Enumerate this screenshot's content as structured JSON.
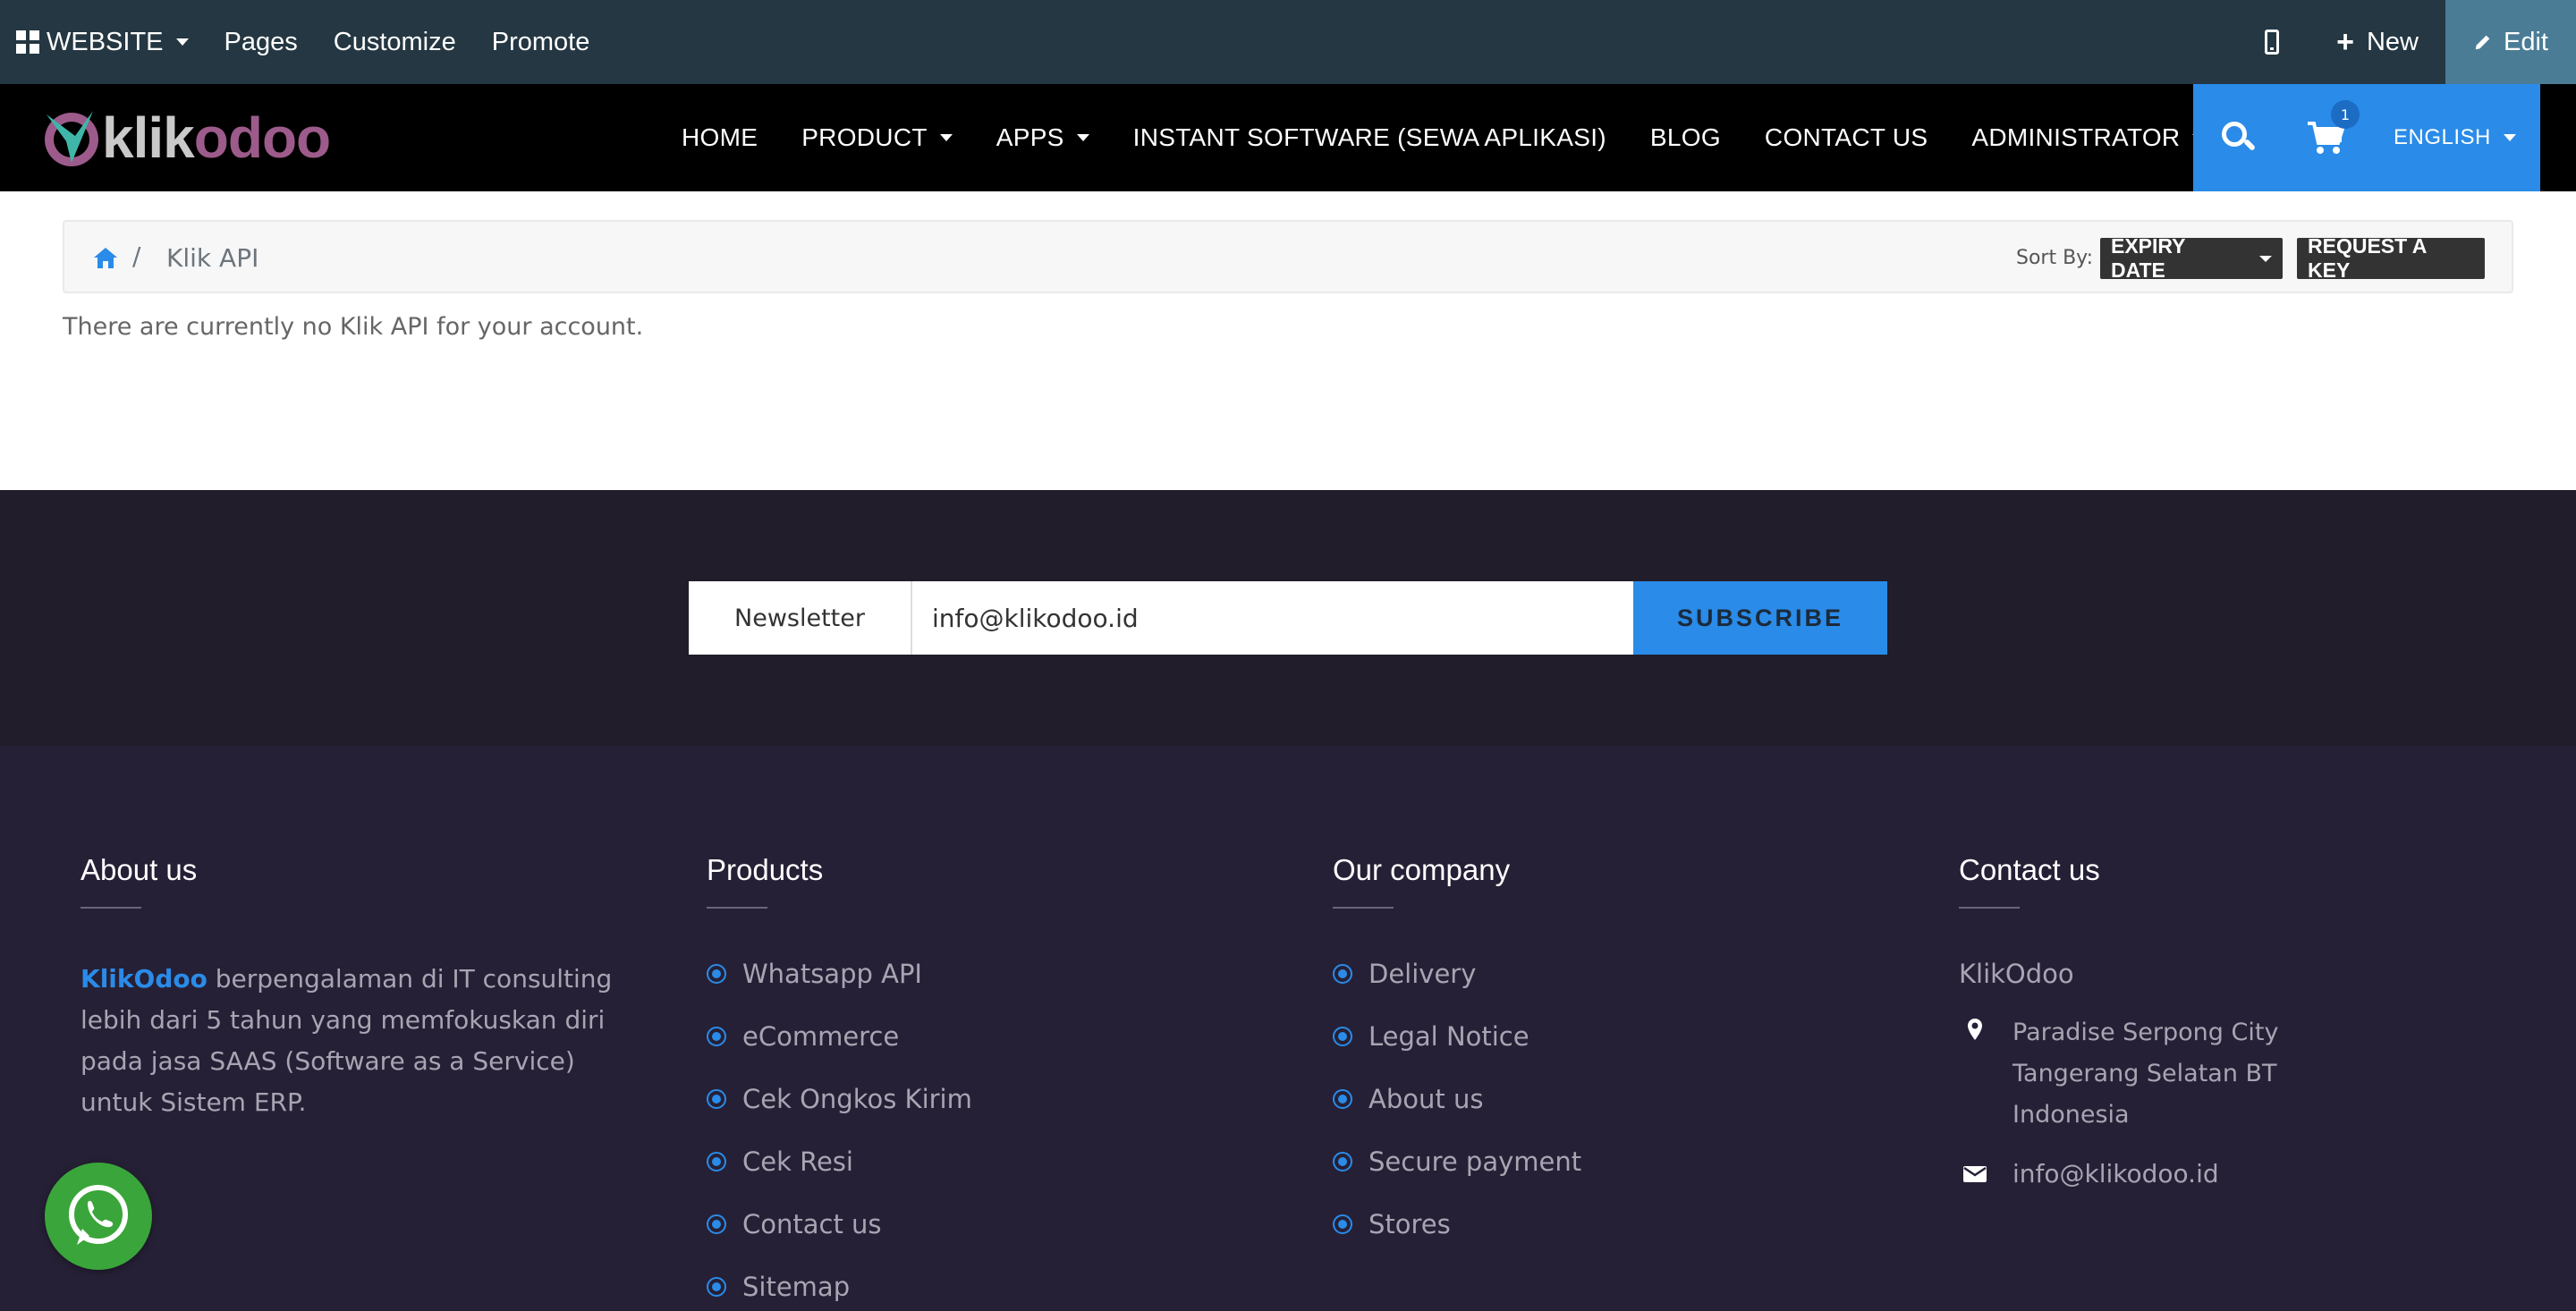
{
  "editbar": {
    "website_label": "WEBSITE",
    "pages_label": "Pages",
    "customize_label": "Customize",
    "promote_label": "Promote",
    "new_label": "New",
    "edit_label": "Edit"
  },
  "nav": {
    "logo_text_a": "klik",
    "logo_text_b": "odoo",
    "links": [
      {
        "label": "HOME",
        "caret": false
      },
      {
        "label": "PRODUCT",
        "caret": true
      },
      {
        "label": "APPS",
        "caret": true
      },
      {
        "label": "INSTANT SOFTWARE (SEWA APLIKASI)",
        "caret": false
      },
      {
        "label": "BLOG",
        "caret": false
      },
      {
        "label": "CONTACT US",
        "caret": false
      },
      {
        "label": "ADMINISTRATOR",
        "caret": true
      }
    ],
    "cart_count": "1",
    "language": "ENGLISH",
    "accent_color": "#2a8be8"
  },
  "breadcrumb": {
    "current": "Klik API",
    "sort_by_label": "Sort By:",
    "sort_value": "EXPIRY DATE",
    "request_key_label": "REQUEST A KEY"
  },
  "main": {
    "empty_message": "There are currently no Klik API for your account."
  },
  "newsletter": {
    "label": "Newsletter",
    "input_value": "info@klikodoo.id",
    "button_label": "SUBSCRIBE"
  },
  "footer": {
    "about": {
      "title": "About us",
      "brand": "KlikOdoo",
      "text": " berpengalaman di IT consulting lebih dari 5 tahun yang memfokuskan diri pada jasa SAAS (Software as a Service) untuk Sistem ERP."
    },
    "products": {
      "title": "Products",
      "items": [
        "Whatsapp API",
        "eCommerce",
        "Cek Ongkos Kirim",
        "Cek Resi",
        "Contact us",
        "Sitemap"
      ]
    },
    "company": {
      "title": "Our company",
      "items": [
        "Delivery",
        "Legal Notice",
        "About us",
        "Secure payment",
        "Stores"
      ]
    },
    "contact": {
      "title": "Contact us",
      "name": "KlikOdoo",
      "address_lines": [
        "Paradise Serpong City",
        "Tangerang Selatan BT",
        "Indonesia"
      ],
      "email": "info@klikodoo.id"
    }
  }
}
